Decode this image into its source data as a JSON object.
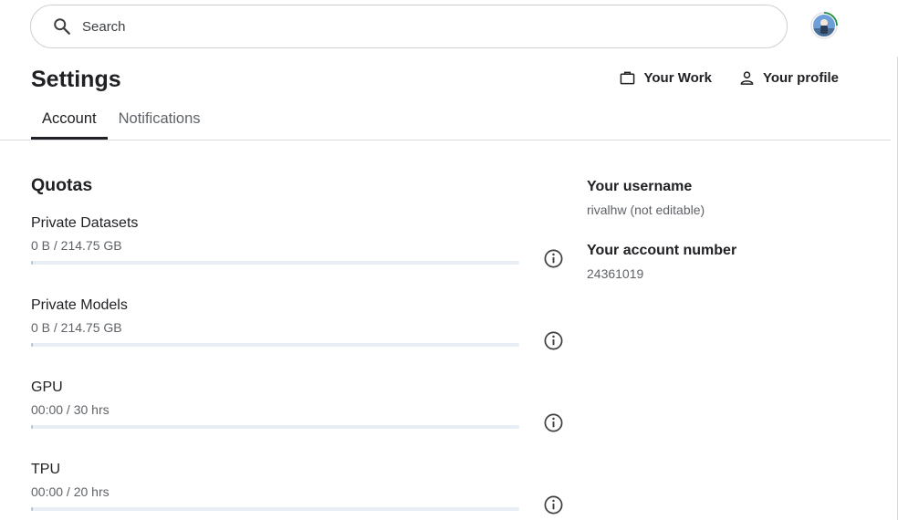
{
  "search": {
    "placeholder": "Search",
    "value": ""
  },
  "header": {
    "title": "Settings",
    "links": [
      {
        "label": "Your Work",
        "icon": "briefcase-icon"
      },
      {
        "label": "Your profile",
        "icon": "person-icon"
      }
    ]
  },
  "tabs": [
    {
      "label": "Account",
      "active": true
    },
    {
      "label": "Notifications",
      "active": false
    }
  ],
  "quotas": {
    "title": "Quotas",
    "items": [
      {
        "label": "Private Datasets",
        "value": "0 B / 214.75 GB",
        "used_fraction": 0
      },
      {
        "label": "Private Models",
        "value": "0 B / 214.75 GB",
        "used_fraction": 0
      },
      {
        "label": "GPU",
        "value": "00:00 / 30 hrs",
        "used_fraction": 0
      },
      {
        "label": "TPU",
        "value": "00:00 / 20 hrs",
        "used_fraction": 0
      }
    ]
  },
  "account": {
    "username_label": "Your username",
    "username_value": "rivalhw (not editable)",
    "number_label": "Your account number",
    "number_value": "24361019"
  },
  "colors": {
    "accent": "#20beff",
    "text": "#202124",
    "muted": "#5f6368",
    "bar_track": "#e8eef4"
  }
}
